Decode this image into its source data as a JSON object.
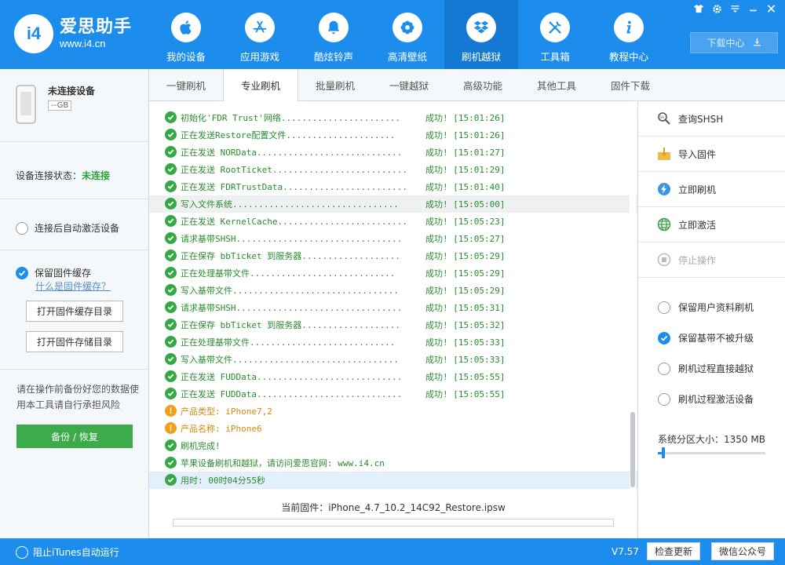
{
  "app": {
    "logo_mark": "i4",
    "logo_title": "爱思助手",
    "logo_url": "www.i4.cn",
    "brand_color": "#1d8ded"
  },
  "nav": [
    {
      "label": "我的设备",
      "icon": "apple-icon"
    },
    {
      "label": "应用游戏",
      "icon": "app-store-icon"
    },
    {
      "label": "酷炫铃声",
      "icon": "bell-icon"
    },
    {
      "label": "高清壁纸",
      "icon": "flower-icon"
    },
    {
      "label": "刷机越狱",
      "icon": "dropbox-icon",
      "active": true
    },
    {
      "label": "工具箱",
      "icon": "tools-icon"
    },
    {
      "label": "教程中心",
      "icon": "info-icon"
    }
  ],
  "window_controls": [
    "shirt-icon",
    "gear-icon",
    "menu-icon",
    "minimize-icon",
    "close-icon"
  ],
  "download_center": "下载中心",
  "left": {
    "device_name": "未连接设备",
    "device_storage": "--GB",
    "connection_label": "设备连接状态：",
    "connection_value": "未连接",
    "auto_activate": "连接后自动激活设备",
    "keep_cache": "保留固件缓存",
    "what_is_cache": "什么是固件缓存？",
    "open_cache_dir": "打开固件缓存目录",
    "open_storage_dir": "打开固件存储目录",
    "warning": "请在操作前备份好您的数据使用本工具请自行承担风险",
    "backup_restore": "备份 / 恢复"
  },
  "tabs": [
    "一键刷机",
    "专业刷机",
    "批量刷机",
    "一键越狱",
    "高级功能",
    "其他工具",
    "固件下载"
  ],
  "active_tab": "专业刷机",
  "log": [
    {
      "type": "ok",
      "text": "初始化'FDR Trust'网络....................... ",
      "result": "成功! [15:01:26]"
    },
    {
      "type": "ok",
      "text": "正在发送Restore配置文件..................... ",
      "result": "成功! [15:01:26]"
    },
    {
      "type": "ok",
      "text": "正在发送 NORData............................ ",
      "result": "成功! [15:01:27]"
    },
    {
      "type": "ok",
      "text": "正在发送 RootTicket.......................... ",
      "result": "成功! [15:01:29]"
    },
    {
      "type": "ok",
      "text": "正在发送 FDRTrustData........................ ",
      "result": "成功! [15:01:40]"
    },
    {
      "type": "ok",
      "text": "写入文件系统................................ ",
      "result": "成功! [15:05:00]",
      "highlight": true
    },
    {
      "type": "ok",
      "text": "正在发送 KernelCache......................... ",
      "result": "成功! [15:05:23]"
    },
    {
      "type": "ok",
      "text": "请求基带SHSH................................ ",
      "result": "成功! [15:05:27]"
    },
    {
      "type": "ok",
      "text": "正在保存 bbTicket 到服务器................... ",
      "result": "成功! [15:05:29]"
    },
    {
      "type": "ok",
      "text": "正在处理基带文件............................ ",
      "result": "成功! [15:05:29]"
    },
    {
      "type": "ok",
      "text": "写入基带文件................................ ",
      "result": "成功! [15:05:29]"
    },
    {
      "type": "ok",
      "text": "请求基带SHSH................................ ",
      "result": "成功! [15:05:31]"
    },
    {
      "type": "ok",
      "text": "正在保存 bbTicket 到服务器................... ",
      "result": "成功! [15:05:32]"
    },
    {
      "type": "ok",
      "text": "正在处理基带文件............................ ",
      "result": "成功! [15:05:33]"
    },
    {
      "type": "ok",
      "text": "写入基带文件................................ ",
      "result": "成功! [15:05:33]"
    },
    {
      "type": "ok",
      "text": "正在发送 FUDData............................ ",
      "result": "成功! [15:05:55]"
    },
    {
      "type": "ok",
      "text": "正在发送 FUDData............................ ",
      "result": "成功! [15:05:55]"
    },
    {
      "type": "warn",
      "text": "产品类型: iPhone7,2",
      "result": ""
    },
    {
      "type": "warn",
      "text": "产品名称: iPhone6",
      "result": ""
    },
    {
      "type": "ok",
      "text": "刷机完成!",
      "result": ""
    },
    {
      "type": "ok",
      "text": "苹果设备刷机和越狱，请访问爱思官网: www.i4.cn",
      "result": ""
    },
    {
      "type": "ok",
      "text": "用时: 00时04分55秒",
      "result": "",
      "selected": true
    }
  ],
  "firmware_label": "当前固件：iPhone_4.7_10.2_14C92_Restore.ipsw",
  "right": {
    "actions": [
      {
        "label": "查询SHSH",
        "icon": "shsh-search-icon"
      },
      {
        "label": "导入固件",
        "icon": "import-icon"
      },
      {
        "label": "立即刷机",
        "icon": "flash-icon"
      },
      {
        "label": "立即激活",
        "icon": "globe-icon"
      },
      {
        "label": "停止操作",
        "icon": "stop-icon",
        "disabled": true
      }
    ],
    "options": [
      {
        "label": "保留用户资料刷机",
        "checked": false
      },
      {
        "label": "保留基带不被升级",
        "checked": true
      },
      {
        "label": "刷机过程直接越狱",
        "checked": false
      },
      {
        "label": "刷机过程激活设备",
        "checked": false
      }
    ],
    "system_partition": "系统分区大小：1350 MB",
    "system_partition_fraction": 0.05
  },
  "footer": {
    "itunes": "阻止iTunes自动运行",
    "version": "V7.57",
    "check_update": "检查更新",
    "wechat": "微信公众号"
  }
}
